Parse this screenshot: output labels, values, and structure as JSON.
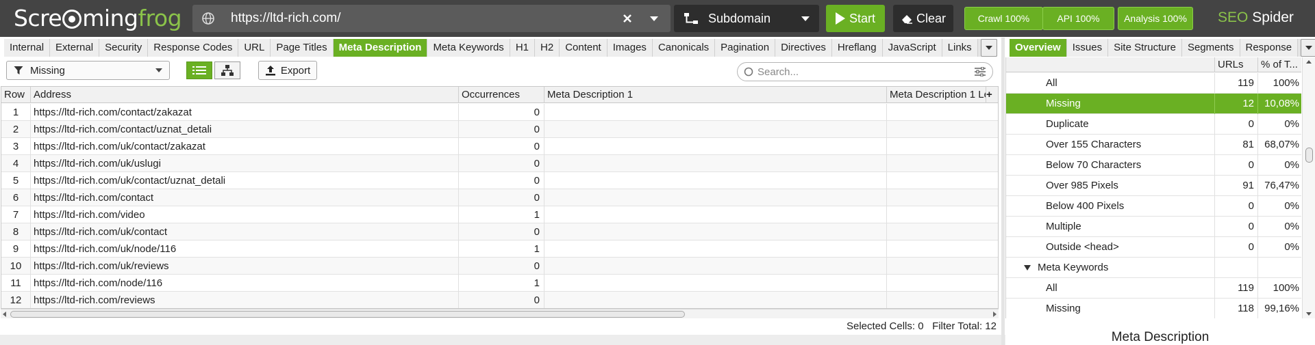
{
  "app": {
    "logo_left": "Scre",
    "logo_right": "ming",
    "logo_frog": "frog",
    "brand_seo": "SEO",
    "brand_spider": "Spider"
  },
  "toolbar": {
    "url": "https://ltd-rich.com/",
    "mode": "Subdomain",
    "start": "Start",
    "clear": "Clear",
    "crawl": "Crawl 100%",
    "api": "API 100%",
    "analysis": "Analysis 100%"
  },
  "main_tabs": [
    "Internal",
    "External",
    "Security",
    "Response Codes",
    "URL",
    "Page Titles",
    "Meta Description",
    "Meta Keywords",
    "H1",
    "H2",
    "Content",
    "Images",
    "Canonicals",
    "Pagination",
    "Directives",
    "Hreflang",
    "JavaScript",
    "Links"
  ],
  "main_tabs_active": "Meta Description",
  "right_tabs": [
    "Overview",
    "Issues",
    "Site Structure",
    "Segments",
    "Response"
  ],
  "right_tabs_active": "Overview",
  "filter": {
    "selected": "Missing"
  },
  "export": "Export",
  "search": {
    "placeholder": "Search..."
  },
  "table": {
    "columns": [
      "Row",
      "Address",
      "Occurrences",
      "Meta Description 1",
      "Meta Description 1 Le"
    ],
    "rows": [
      {
        "row": "1",
        "address": "https://ltd-rich.com/contact/zakazat",
        "occurrences": "0"
      },
      {
        "row": "2",
        "address": "https://ltd-rich.com/contact/uznat_detali",
        "occurrences": "0"
      },
      {
        "row": "3",
        "address": "https://ltd-rich.com/uk/contact/zakazat",
        "occurrences": "0"
      },
      {
        "row": "4",
        "address": "https://ltd-rich.com/uk/uslugi",
        "occurrences": "0"
      },
      {
        "row": "5",
        "address": "https://ltd-rich.com/uk/contact/uznat_detali",
        "occurrences": "0"
      },
      {
        "row": "6",
        "address": "https://ltd-rich.com/contact",
        "occurrences": "0"
      },
      {
        "row": "7",
        "address": "https://ltd-rich.com/video",
        "occurrences": "1"
      },
      {
        "row": "8",
        "address": "https://ltd-rich.com/uk/contact",
        "occurrences": "0"
      },
      {
        "row": "9",
        "address": "https://ltd-rich.com/uk/node/116",
        "occurrences": "1"
      },
      {
        "row": "10",
        "address": "https://ltd-rich.com/uk/reviews",
        "occurrences": "0"
      },
      {
        "row": "11",
        "address": "https://ltd-rich.com/node/116",
        "occurrences": "1"
      },
      {
        "row": "12",
        "address": "https://ltd-rich.com/reviews",
        "occurrences": "0"
      }
    ]
  },
  "status": {
    "selected_cells": "Selected Cells:  0",
    "filter_total": "Filter Total:  12"
  },
  "overview": {
    "columns": [
      "URLs",
      "% of T..."
    ],
    "rows": [
      {
        "label": "All",
        "urls": "119",
        "pct": "100%",
        "type": "item"
      },
      {
        "label": "Missing",
        "urls": "12",
        "pct": "10,08%",
        "type": "item",
        "selected": true
      },
      {
        "label": "Duplicate",
        "urls": "0",
        "pct": "0%",
        "type": "item"
      },
      {
        "label": "Over 155 Characters",
        "urls": "81",
        "pct": "68,07%",
        "type": "item"
      },
      {
        "label": "Below 70 Characters",
        "urls": "0",
        "pct": "0%",
        "type": "item"
      },
      {
        "label": "Over 985 Pixels",
        "urls": "91",
        "pct": "76,47%",
        "type": "item"
      },
      {
        "label": "Below 400 Pixels",
        "urls": "0",
        "pct": "0%",
        "type": "item"
      },
      {
        "label": "Multiple",
        "urls": "0",
        "pct": "0%",
        "type": "item"
      },
      {
        "label": "Outside <head>",
        "urls": "0",
        "pct": "0%",
        "type": "item"
      },
      {
        "label": "Meta Keywords",
        "urls": "",
        "pct": "",
        "type": "group"
      },
      {
        "label": "All",
        "urls": "119",
        "pct": "100%",
        "type": "item"
      },
      {
        "label": "Missing",
        "urls": "118",
        "pct": "99,16%",
        "type": "item"
      }
    ]
  },
  "detail": {
    "title": "Meta Description"
  },
  "colors": {
    "accent": "#6ab023",
    "topbar": "#444444",
    "dark": "#2d2d2d"
  }
}
